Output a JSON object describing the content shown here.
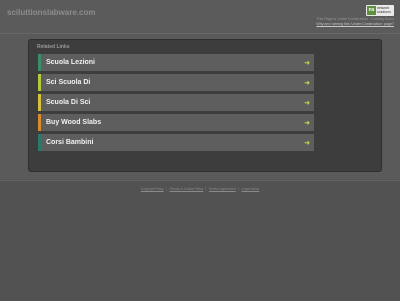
{
  "header": {
    "domain": "sciluttionslabware.com",
    "brand": {
      "mark": "ns",
      "line1": "network",
      "line2": "solutions"
    },
    "notice": "This Page is Under Construction - Coming Soon!",
    "register_link": "Why am I seeing this 'Under Construction' page?"
  },
  "related": {
    "title": "Related Links",
    "items": [
      {
        "label": "Scuola Lezioni",
        "color": "#3a8f6a"
      },
      {
        "label": "Sci Scuola Di",
        "color": "#b5c93a"
      },
      {
        "label": "Scuola Di Sci",
        "color": "#d6c23a"
      },
      {
        "label": "Buy Wood Slabs",
        "color": "#d98c2a"
      },
      {
        "label": "Corsi Bambini",
        "color": "#2a7a6e"
      }
    ],
    "arrow": "➜"
  },
  "footer": {
    "links": [
      "Copyright Policy",
      "Privacy & Cookie Policy",
      "Service Agreement",
      "Legal Notice"
    ]
  }
}
